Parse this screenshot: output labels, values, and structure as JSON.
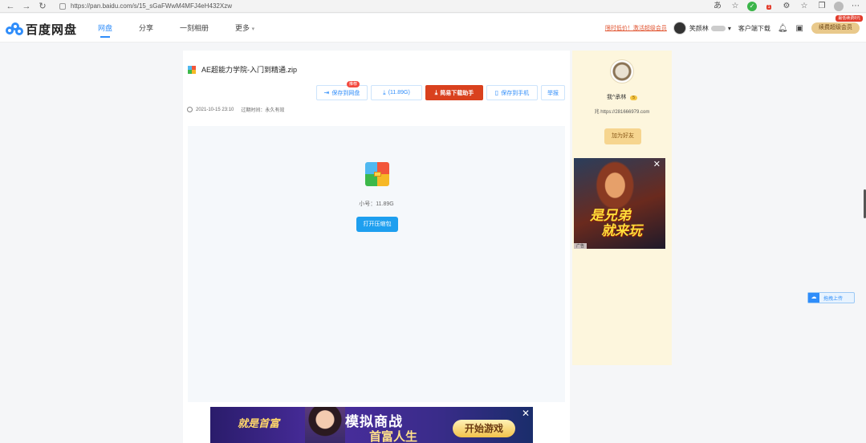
{
  "browser": {
    "url": "https://pan.baidu.com/s/15_sGaFWwM4MFJ4eH432Xzw",
    "back_icon": "back-arrow-icon",
    "forward_icon": "forward-arrow-icon",
    "reload_icon": "reload-icon",
    "notification_count": "1"
  },
  "header": {
    "logo_text": "百度网盘",
    "nav": [
      {
        "label": "网盘",
        "active": true
      },
      {
        "label": "分享",
        "active": false
      },
      {
        "label": "一刻相册",
        "active": false
      },
      {
        "label": "更多",
        "active": false
      }
    ],
    "promo_link": "限时低价！激活超级会员",
    "username": "笑颜林",
    "client_download": "客户端下载",
    "svip_button": "续费超级会员",
    "svip_tag": "最低续费8元"
  },
  "file": {
    "name": "AE超能力学院-入门到精通.zip",
    "created": "2021-10-15 23:10",
    "expiry": "过期时间：永久有效",
    "size_label": "小号：11.89G"
  },
  "actions": {
    "save": "保存到网盘",
    "save_tip": "推荐",
    "download": "(11.89G)",
    "helper": "简易下载助手",
    "save_phone": "保存到手机",
    "report": "举报"
  },
  "preview": {
    "open_button": "打开压缩包"
  },
  "sidebar": {
    "share_user": "我^承林",
    "level": "5",
    "share_url": "兆 https://281666979.com",
    "add_friend": "加为好友",
    "ad_text_line1": "是兄弟",
    "ad_text_line2": "就来玩",
    "ad_tag": "广告"
  },
  "bottom_ad": {
    "left_text": "就是首富",
    "title": "模拟商战",
    "subtitle": "首富人生",
    "play": "开始游戏"
  },
  "float": {
    "upload": "拖拽上传"
  },
  "colors": {
    "primary": "#2f8dfa",
    "download_red": "#d9411e",
    "sidebar_bg": "#fdf6dd"
  }
}
